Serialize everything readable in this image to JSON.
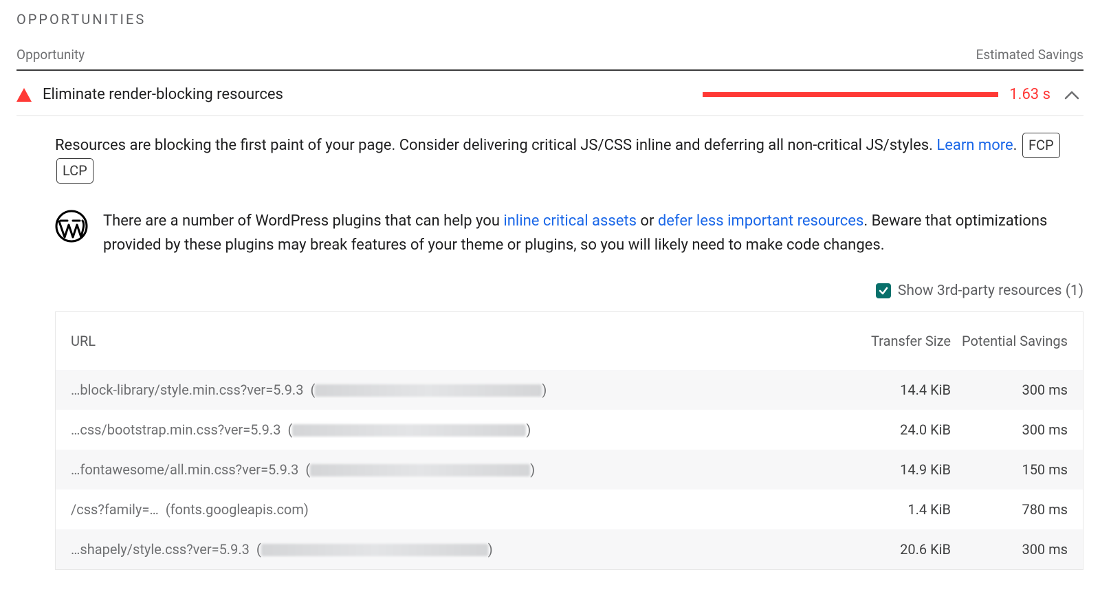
{
  "section_title": "OPPORTUNITIES",
  "header": {
    "left": "Opportunity",
    "right": "Estimated Savings"
  },
  "audit": {
    "title": "Eliminate render-blocking resources",
    "savings": "1.63 s",
    "bar_color": "#ff3935"
  },
  "description": {
    "text_before_link": "Resources are blocking the first paint of your page. Consider delivering critical JS/CSS inline and deferring all non-critical JS/styles. ",
    "link_text": "Learn more",
    "after_link": ".",
    "tags": [
      "FCP",
      "LCP"
    ]
  },
  "wordpress_tip": {
    "part1": "There are a number of WordPress plugins that can help you ",
    "link1": "inline critical assets",
    "mid": " or ",
    "link2": "defer less important resources",
    "part2": ". Beware that optimizations provided by these plugins may break features of your theme or plugins, so you will likely need to make code changes."
  },
  "show_third_party": {
    "checked": true,
    "label": "Show 3rd-party resources (1)"
  },
  "table": {
    "headers": {
      "url": "URL",
      "size": "Transfer Size",
      "savings": "Potential Savings"
    },
    "rows": [
      {
        "url": "…block-library/style.min.css?ver=5.9.3",
        "host_open": "(",
        "host_close": ")",
        "host_hidden": true,
        "blur_w": 330,
        "size": "14.4 KiB",
        "savings": "300 ms"
      },
      {
        "url": "…css/bootstrap.min.css?ver=5.9.3",
        "host_open": "(",
        "host_close": ")",
        "host_hidden": true,
        "blur_w": 340,
        "size": "24.0 KiB",
        "savings": "300 ms"
      },
      {
        "url": "…fontawesome/all.min.css?ver=5.9.3",
        "host_open": "(",
        "host_close": ")",
        "host_hidden": true,
        "blur_w": 320,
        "size": "14.9 KiB",
        "savings": "150 ms"
      },
      {
        "url": "/css?family=…",
        "host_open": "(",
        "host_close": ")",
        "host": "fonts.googleapis.com",
        "host_hidden": false,
        "blur_w": 0,
        "size": "1.4 KiB",
        "savings": "780 ms"
      },
      {
        "url": "…shapely/style.css?ver=5.9.3",
        "host_open": "(",
        "host_close": ")",
        "host_hidden": true,
        "blur_w": 330,
        "size": "20.6 KiB",
        "savings": "300 ms"
      }
    ]
  }
}
